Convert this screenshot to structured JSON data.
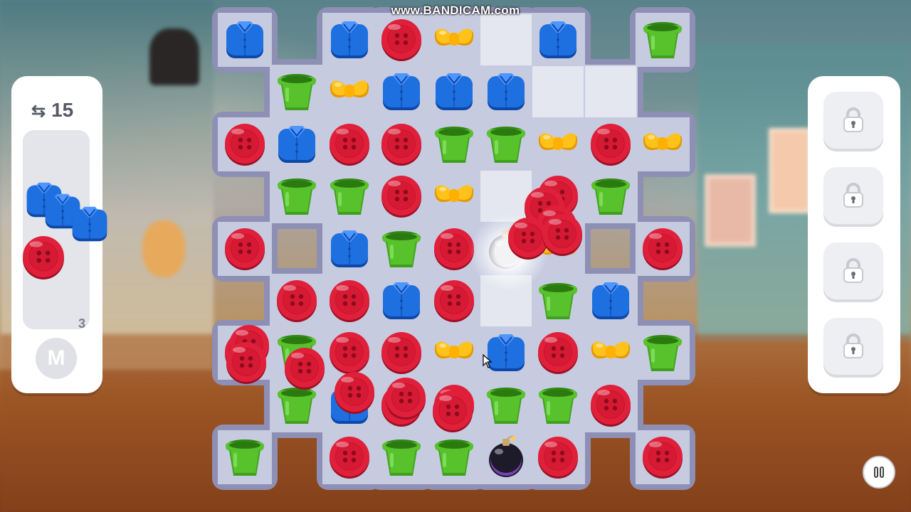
{
  "watermark": "www.BANDICAM.com",
  "moves": {
    "icon": "swap-arrows-icon",
    "value": "15"
  },
  "goal": {
    "item": "shirt",
    "remaining": "3"
  },
  "m_button_label": "M",
  "boosters": [
    {
      "state": "locked",
      "icon": "lock-icon"
    },
    {
      "state": "locked",
      "icon": "lock-icon"
    },
    {
      "state": "locked",
      "icon": "lock-icon"
    },
    {
      "state": "locked",
      "icon": "lock-icon"
    }
  ],
  "pause_icon": "pause-icon",
  "colors": {
    "button_red": "#e0203a",
    "shirt_blue": "#1e6fe0",
    "pot_green": "#58c22c",
    "bow_yellow": "#ffc21a",
    "board_frame": "#8e8fb5",
    "board_cell": "#c6cbe0"
  },
  "board": {
    "cols": 9,
    "rows": 9,
    "legend": {
      "R": "red-button",
      "B": "blue-shirt",
      "G": "green-pot",
      "Y": "yellow-bow",
      "K": "bomb",
      "X": "no-cell",
      "E": "empty-cell"
    },
    "grid": [
      [
        "B",
        "X",
        "B",
        "R",
        "Y",
        "E",
        "B",
        "X",
        "G"
      ],
      [
        "X",
        "G",
        "Y",
        "B",
        "B",
        "B",
        "E",
        "E",
        "X"
      ],
      [
        "R",
        "B",
        "R",
        "R",
        "G",
        "G",
        "Y",
        "R",
        "Y"
      ],
      [
        "X",
        "G",
        "G",
        "R",
        "Y",
        "E",
        "R",
        "G",
        "X"
      ],
      [
        "R",
        "X",
        "B",
        "G",
        "R",
        "K",
        "Y",
        "X",
        "R"
      ],
      [
        "X",
        "R",
        "R",
        "B",
        "R",
        "E",
        "G",
        "B",
        "X"
      ],
      [
        "R",
        "G",
        "R",
        "R",
        "Y",
        "B",
        "R",
        "Y",
        "G"
      ],
      [
        "X",
        "G",
        "B",
        "R",
        "R",
        "G",
        "G",
        "R",
        "X"
      ],
      [
        "G",
        "X",
        "R",
        "G",
        "G",
        "K",
        "R",
        "X",
        "R"
      ]
    ]
  }
}
